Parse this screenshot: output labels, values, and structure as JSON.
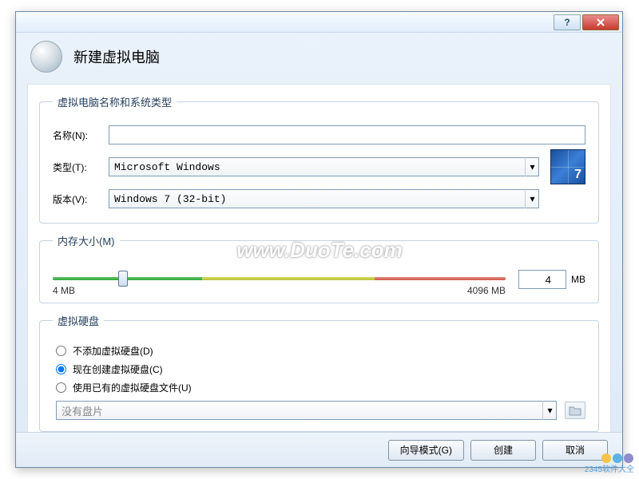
{
  "window": {
    "title": "新建虚拟电脑"
  },
  "group_os": {
    "legend": "虚拟电脑名称和系统类型",
    "name_label": "名称(N):",
    "name_value": "",
    "type_label": "类型(T):",
    "type_value": "Microsoft Windows",
    "version_label": "版本(V):",
    "version_value": "Windows 7 (32-bit)",
    "os_badge": "7"
  },
  "group_mem": {
    "legend": "内存大小(M)",
    "min_label": "4 MB",
    "max_label": "4096 MB",
    "value": "4",
    "unit": "MB"
  },
  "group_disk": {
    "legend": "虚拟硬盘",
    "opt_none": "不添加虚拟硬盘(D)",
    "opt_create": "现在创建虚拟硬盘(C)",
    "opt_existing": "使用已有的虚拟硬盘文件(U)",
    "file_placeholder": "没有盘片"
  },
  "footer": {
    "guided": "向导模式(G)",
    "create": "创建",
    "cancel": "取消"
  },
  "watermark": "www.DuoTe.com",
  "corner": "2345软件大全"
}
